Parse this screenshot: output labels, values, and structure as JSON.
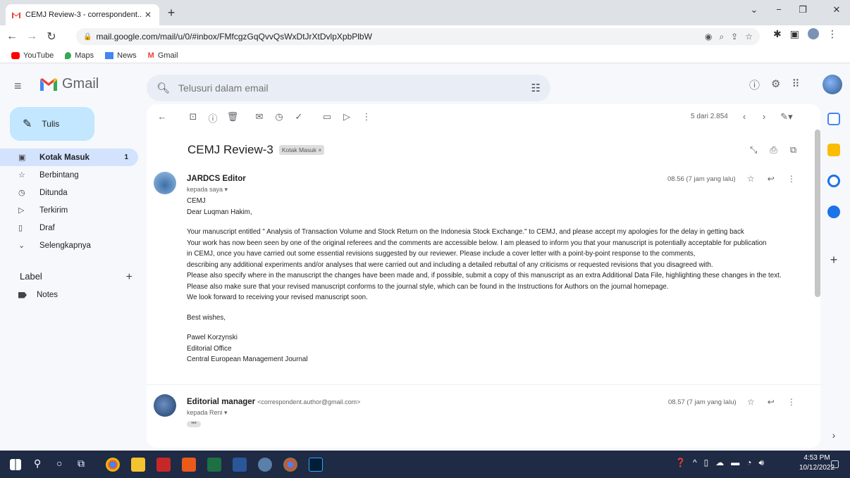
{
  "browser": {
    "tab_title": "CEMJ Review-3 - correspondent...",
    "tab_close": "✕",
    "new_tab": "+",
    "window_controls": [
      "⌄",
      "−",
      "❐",
      "✕"
    ],
    "url": "mail.google.com/mail/u/0/#inbox/FMfcgzGqQvvQsWxDtJrXtDvlpXpbPlbW",
    "bookmarks": [
      "YouTube",
      "Maps",
      "News",
      "Gmail"
    ]
  },
  "gmail": {
    "app_name": "Gmail",
    "search_placeholder": "Telusuri dalam email",
    "compose_label": "Tulis",
    "nav": [
      {
        "label": "Kotak Masuk",
        "count": "1",
        "icon": "inbox-icon"
      },
      {
        "label": "Berbintang",
        "count": "",
        "icon": "star-icon"
      },
      {
        "label": "Ditunda",
        "count": "",
        "icon": "clock-icon"
      },
      {
        "label": "Terkirim",
        "count": "",
        "icon": "send-icon"
      },
      {
        "label": "Draf",
        "count": "",
        "icon": "draft-icon"
      },
      {
        "label": "Selengkapnya",
        "count": "",
        "icon": "chevron-down-icon"
      }
    ],
    "labels_header": "Label",
    "labels": [
      "Notes"
    ]
  },
  "thread": {
    "pager": "5 dari 2.854",
    "subject": "CEMJ Review-3",
    "subject_chip": "Kotak Masuk ×",
    "messages": [
      {
        "sender": "JARDCS Editor",
        "email": "",
        "to": "kepada saya ▾",
        "time": "08.56 (7 jam yang lalu)"
      },
      {
        "sender": "Editorial manager",
        "email": "<correspondent.author@gmail.com>",
        "to": "kepada Reni ▾",
        "time": "08.57 (7 jam yang lalu)"
      }
    ],
    "body": {
      "line1": "CEMJ",
      "line2": "Dear Luqman Hakim,",
      "p1": "Your manuscript entitled \" Analysis of Transaction Volume and Stock Return on the Indonesia Stock Exchange.\" to CEMJ, and please accept my apologies for the delay in getting back",
      "p2": "Your work has now been seen by  one of the original referees and the comments are accessible below. I am pleased to inform you that your manuscript is potentially acceptable for publication",
      "p3": "in CEMJ, once you have carried out some essential revisions suggested by our reviewer. Please include a cover letter with a point-by-point response to the comments,",
      "p4": "describing any additional experiments and/or analyses that were carried out and including a detailed rebuttal of any criticisms or requested revisions that you disagreed with.",
      "p5": "Please also specify where in the manuscript the changes  have been made and, if possible, submit a copy of this manuscript as an extra Additional Data File, highlighting these changes in the text.",
      "p6": "Please also make sure that your revised manuscript conforms to the journal style, which can be found in the Instructions for Authors on the journal homepage.",
      "p7": "We look forward to receiving your revised manuscript soon.",
      "closing": "Best wishes,",
      "sig1": "Pawel Korzynski",
      "sig2": "Editorial Office",
      "sig3": "Central European Management Journal"
    },
    "collapsed_dots": "•••"
  },
  "taskbar": {
    "time": "4:53 PM",
    "date": "10/12/2022"
  }
}
